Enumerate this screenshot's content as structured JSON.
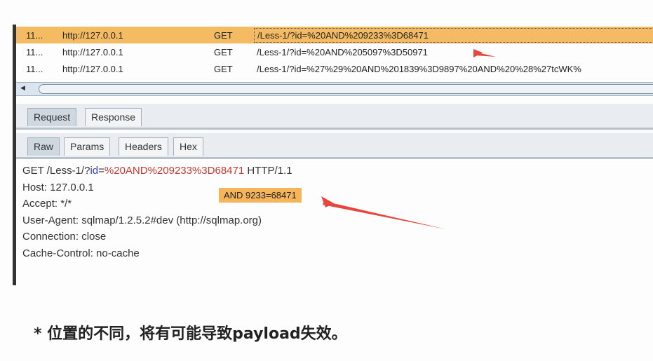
{
  "history": {
    "rows": [
      {
        "num": "11...",
        "host": "http://127.0.0.1",
        "method": "GET",
        "url": "/Less-1/?id=%20AND%209233%3D68471",
        "selected": true
      },
      {
        "num": "11...",
        "host": "http://127.0.0.1",
        "method": "GET",
        "url": "/Less-1/?id=%20AND%205097%3D50971",
        "selected": false
      },
      {
        "num": "11...",
        "host": "http://127.0.0.1",
        "method": "GET",
        "url": "/Less-1/?id=%27%29%20AND%201839%3D9897%20AND%20%28%27tcWK%",
        "selected": false
      }
    ]
  },
  "tabs_top": {
    "request": "Request",
    "response": "Response"
  },
  "tabs_sub": {
    "raw": "Raw",
    "params": "Params",
    "headers": "Headers",
    "hex": "Hex"
  },
  "request": {
    "line1_prefix": "GET /Less-1/?",
    "line1_param": "id",
    "line1_eq": "=",
    "line1_payload": "%20AND%209233%3D68471",
    "line1_suffix": " HTTP/1.1",
    "host": "Host: 127.0.0.1",
    "accept": "Accept: */*",
    "user_agent": "User-Agent: sqlmap/1.2.5.2#dev (http://sqlmap.org)",
    "connection": "Connection: close",
    "cache_control": "Cache-Control: no-cache"
  },
  "annotation": {
    "decoded": "AND 9233=68471"
  },
  "caption": "* 位置的不同，将有可能导致payload失效。",
  "colors": {
    "selected_row": "#f5bb62",
    "payload": "#c43a34",
    "param": "#2d3fc9",
    "arrow": "#e8453c"
  }
}
